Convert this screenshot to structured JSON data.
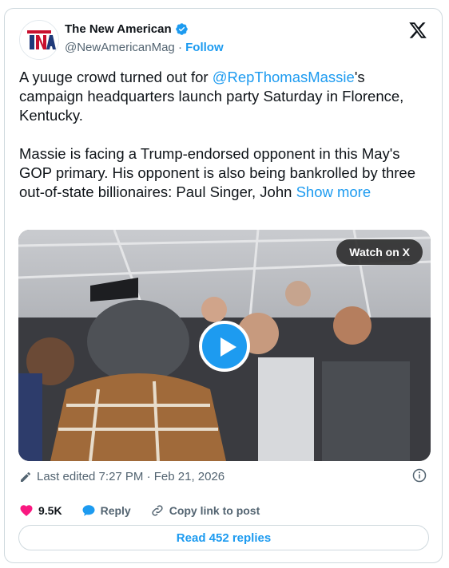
{
  "author": {
    "name": "The New American",
    "handle": "@NewAmericanMag",
    "separator": "·",
    "follow_label": "Follow",
    "avatar_text": "TNA"
  },
  "tweet": {
    "line1_before": "A yuuge crowd turned out for ",
    "mention": "@RepThomasMassie",
    "line1_after": "'s campaign headquarters launch party Saturday in Florence, Kentucky.",
    "paragraph2": "Massie is facing a Trump-endorsed opponent in this May's GOP primary. His opponent is also being bankrolled by three out-of-state billionaires: Paul Singer, John ",
    "show_more": "Show more"
  },
  "media": {
    "watch_label": "Watch on X"
  },
  "meta": {
    "edited_text": "Last edited 7:27 PM · Feb 21, 2026"
  },
  "actions": {
    "likes": "9.5K",
    "reply_label": "Reply",
    "copy_label": "Copy link to post"
  },
  "footer": {
    "read_replies": "Read 452 replies"
  },
  "colors": {
    "accent": "#1d9bf0",
    "like": "#f91880",
    "muted": "#536471"
  }
}
